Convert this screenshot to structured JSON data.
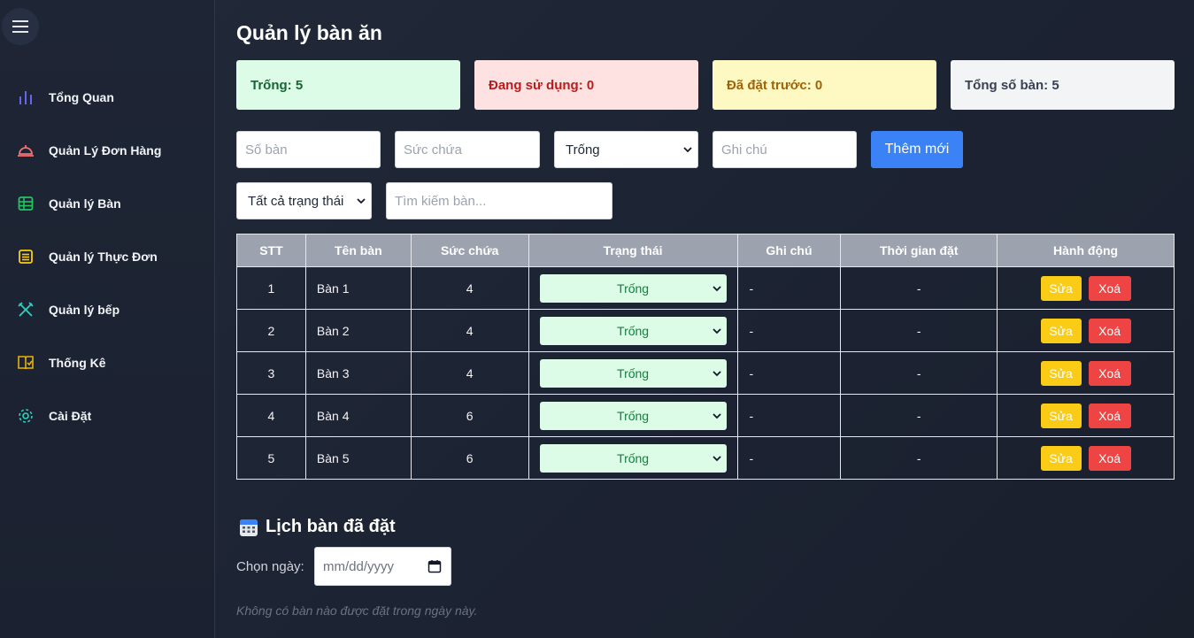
{
  "sidebar": {
    "items": [
      {
        "label": "Tổng Quan",
        "icon": "bar-chart-icon",
        "color": "#6366f1"
      },
      {
        "label": "Quản Lý Đơn Hàng",
        "icon": "service-bell-icon",
        "color": "#f87171"
      },
      {
        "label": "Quản lý Bàn",
        "icon": "table-grid-icon",
        "color": "#22c55e"
      },
      {
        "label": "Quản lý Thực Đơn",
        "icon": "list-icon",
        "color": "#facc15"
      },
      {
        "label": "Quản lý bếp",
        "icon": "utensils-icon",
        "color": "#2dd4bf"
      },
      {
        "label": "Thống Kê",
        "icon": "checkbook-icon",
        "color": "#eab308"
      },
      {
        "label": "Cài Đặt",
        "icon": "gear-icon",
        "color": "#2dd4bf"
      }
    ]
  },
  "page": {
    "title": "Quản lý bàn ăn"
  },
  "stats": {
    "free": "Trống: 5",
    "busy": "Đang sử dụng: 0",
    "reserved": "Đã đặt trước: 0",
    "total": "Tổng số bàn: 5"
  },
  "form": {
    "table_no_placeholder": "Số bàn",
    "capacity_placeholder": "Sức chứa",
    "status_value": "Trống",
    "note_placeholder": "Ghi chú",
    "add_label": "Thêm mới"
  },
  "filter": {
    "status_value": "Tất cả trạng thái",
    "search_placeholder": "Tìm kiếm bàn..."
  },
  "table": {
    "headers": [
      "STT",
      "Tên bàn",
      "Sức chứa",
      "Trạng thái",
      "Ghi chú",
      "Thời gian đặt",
      "Hành động"
    ],
    "rows": [
      {
        "stt": "1",
        "name": "Bàn 1",
        "capacity": "4",
        "status": "Trống",
        "note": "-",
        "time": "-"
      },
      {
        "stt": "2",
        "name": "Bàn 2",
        "capacity": "4",
        "status": "Trống",
        "note": "-",
        "time": "-"
      },
      {
        "stt": "3",
        "name": "Bàn 3",
        "capacity": "4",
        "status": "Trống",
        "note": "-",
        "time": "-"
      },
      {
        "stt": "4",
        "name": "Bàn 4",
        "capacity": "6",
        "status": "Trống",
        "note": "-",
        "time": "-"
      },
      {
        "stt": "5",
        "name": "Bàn 5",
        "capacity": "6",
        "status": "Trống",
        "note": "-",
        "time": "-"
      }
    ],
    "edit_label": "Sửa",
    "delete_label": "Xoá"
  },
  "schedule": {
    "title": "Lịch bàn đã đặt",
    "date_label": "Chọn ngày:",
    "date_placeholder": "mm/dd/yyyy",
    "empty": "Không có bàn nào được đặt trong ngày này."
  }
}
